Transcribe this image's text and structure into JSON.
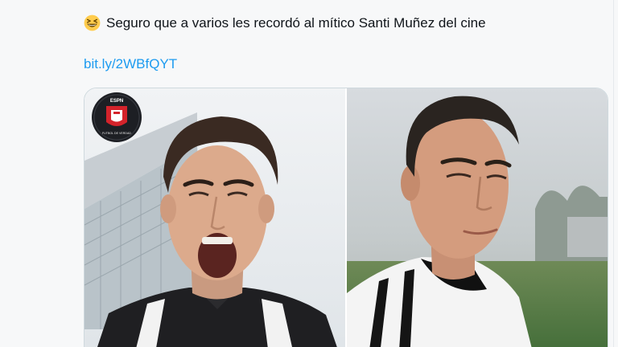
{
  "tweet": {
    "emoji_icon": "grinning-squinting-face-icon",
    "text": "Seguro que a varios les recordó al mítico Santi Muñez del cine",
    "link_text": "bit.ly/2WBfQYT",
    "link_color": "#1d9bf0"
  },
  "media": {
    "left_image": "young-footballer-shouting-photo",
    "right_image": "actor-in-black-white-jersey-photo",
    "badge_icon": "espn-futbol-de-verdad-logo-icon",
    "badge_top_text": "ESPN",
    "badge_bottom_text": "FUTBOL DE VERDAD"
  },
  "colors": {
    "text": "#0f1419",
    "border": "#cfd9de",
    "background": "#f7f8f9"
  }
}
